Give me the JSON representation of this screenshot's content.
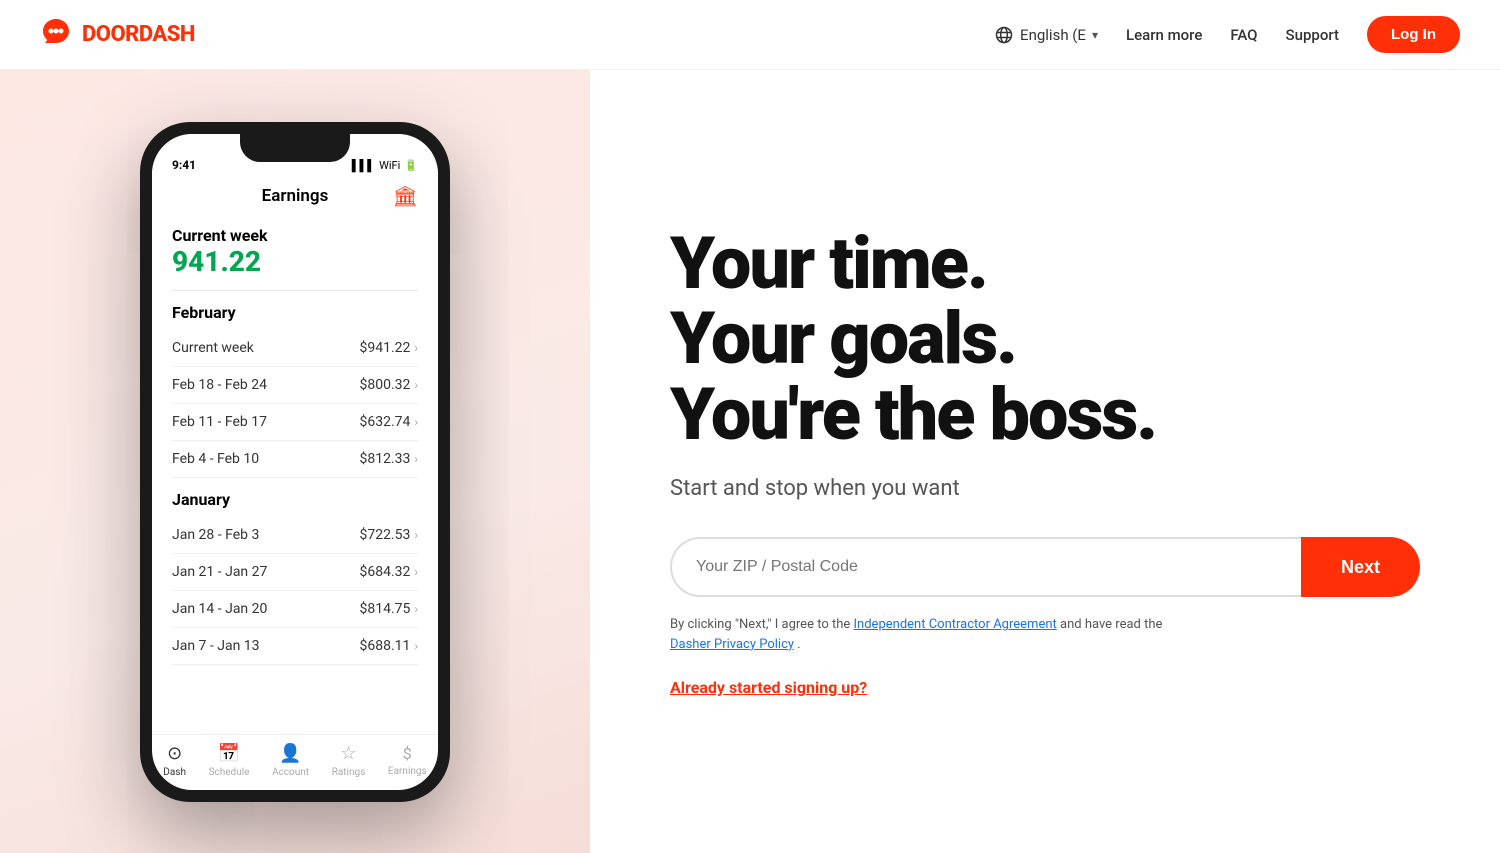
{
  "header": {
    "logo_text": "DOORDASH",
    "lang": "English (E",
    "learn_more": "Learn more",
    "faq": "FAQ",
    "support": "Support",
    "login": "Log In"
  },
  "phone": {
    "screen_title": "Earnings",
    "current_week_label": "Current week",
    "current_week_amount": "941.22",
    "february_label": "February",
    "february_rows": [
      {
        "label": "Current week",
        "amount": "$941.22"
      },
      {
        "label": "Feb 18 - Feb 24",
        "amount": "$800.32"
      },
      {
        "label": "Feb 11 - Feb 17",
        "amount": "$632.74"
      },
      {
        "label": "Feb 4 - Feb 10",
        "amount": "$812.33"
      }
    ],
    "january_label": "January",
    "january_rows": [
      {
        "label": "Jan 28 - Feb 3",
        "amount": "$722.53"
      },
      {
        "label": "Jan 21 - Jan 27",
        "amount": "$684.32"
      },
      {
        "label": "Jan 14 - Jan 20",
        "amount": "$814.75"
      },
      {
        "label": "Jan 7 - Jan 13",
        "amount": "$688.11"
      }
    ],
    "nav_items": [
      {
        "icon": "⊙",
        "label": "Dash"
      },
      {
        "icon": "📅",
        "label": "Schedule"
      },
      {
        "icon": "👤",
        "label": "Account"
      },
      {
        "icon": "☆",
        "label": "Ratings"
      },
      {
        "icon": "$",
        "label": "Earnings"
      }
    ]
  },
  "hero": {
    "line1": "Your time.",
    "line2": "Your goals.",
    "line3": "You're the boss.",
    "subtitle": "Start and stop when you want",
    "zip_placeholder": "Your ZIP / Postal Code",
    "next_label": "Next",
    "terms_text": "By clicking \"Next,\" I agree to the",
    "terms_link1": "Independent Contractor Agreement",
    "terms_mid": " and have read the ",
    "terms_link2": "Dasher Privacy Policy",
    "terms_end": ".",
    "already_link": "Already started signing up?"
  }
}
